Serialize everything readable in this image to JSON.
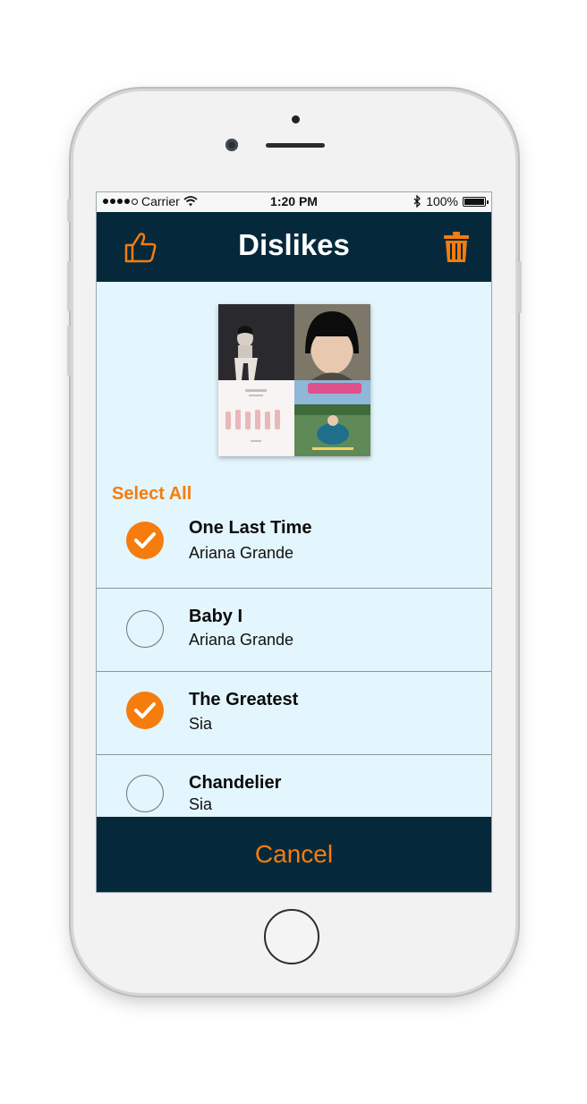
{
  "status_bar": {
    "signal_carrier": "Carrier",
    "time": "1:20 PM",
    "battery": "100%"
  },
  "nav": {
    "title": "Dislikes",
    "left_icon": "thumbs-up-icon",
    "right_icon": "trash-icon"
  },
  "album_art": {
    "label": "album-collage"
  },
  "select_all_label": "Select All",
  "songs": [
    {
      "title": "One Last Time",
      "artist": "Ariana Grande",
      "selected": true
    },
    {
      "title": "Baby I",
      "artist": "Ariana Grande",
      "selected": false
    },
    {
      "title": "The Greatest",
      "artist": "Sia",
      "selected": true
    },
    {
      "title": "Chandelier",
      "artist": "Sia",
      "selected": false
    }
  ],
  "cancel_label": "Cancel",
  "colors": {
    "accent": "#f57c0d",
    "navbar": "#05293a",
    "background": "#e3f5fd"
  }
}
